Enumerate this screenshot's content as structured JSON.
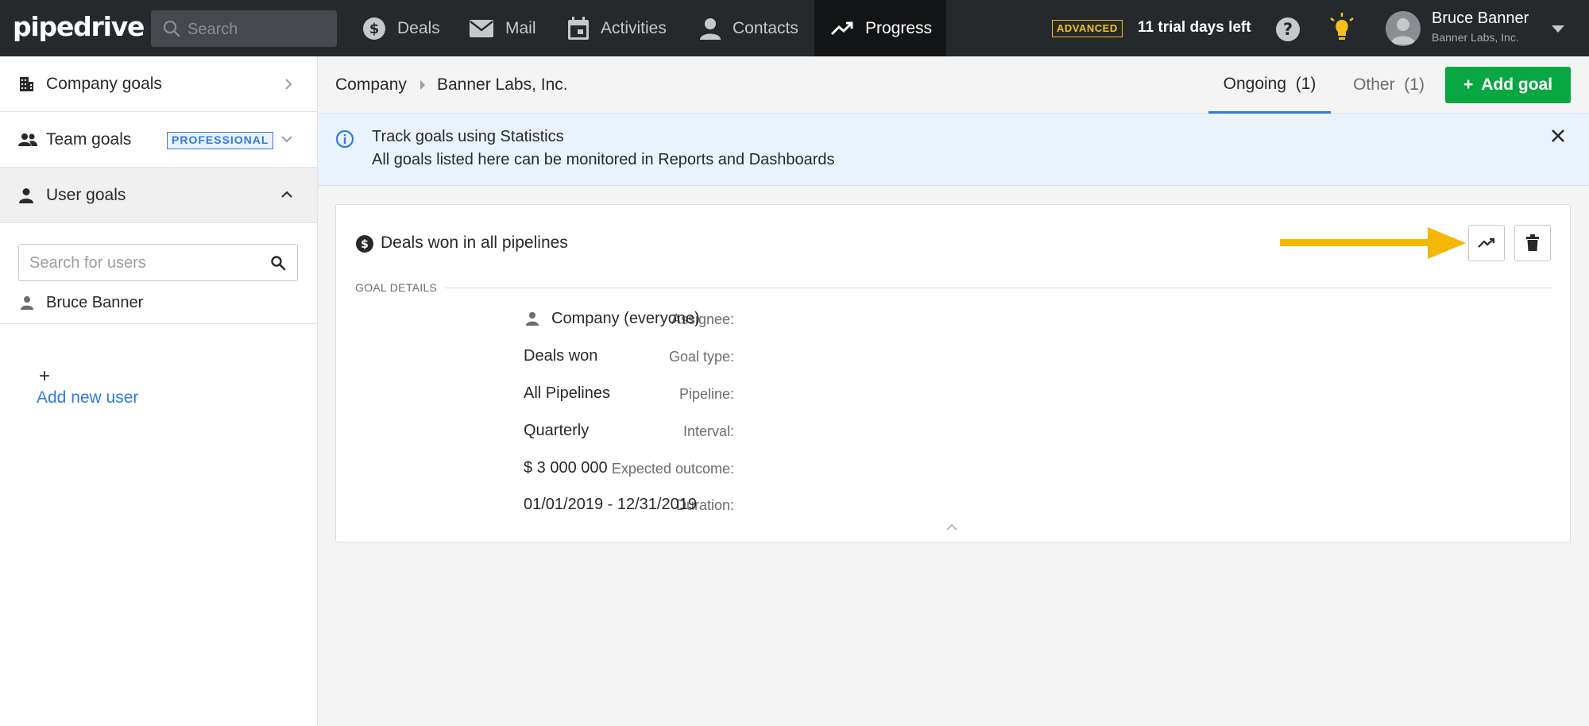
{
  "app": {
    "logo_text": "pipedrive",
    "search_placeholder": "Search",
    "nav": {
      "deals": "Deals",
      "mail": "Mail",
      "activities": "Activities",
      "contacts": "Contacts",
      "progress": "Progress"
    },
    "plan_badge": "ADVANCED",
    "trial_text": "11 trial days left",
    "user_name": "Bruce Banner",
    "user_company": "Banner Labs, Inc."
  },
  "sidebar": {
    "company_goals": "Company goals",
    "team_goals": "Team goals",
    "team_badge": "PROFESSIONAL",
    "user_goals": "User goals",
    "user_search_placeholder": "Search for users",
    "users": [
      "Bruce Banner"
    ],
    "add_plus": "+",
    "add_new_user": "Add new user"
  },
  "header": {
    "breadcrumb_root": "Company",
    "breadcrumb_current": "Banner Labs, Inc.",
    "tab_ongoing": "Ongoing",
    "tab_ongoing_count": "(1)",
    "tab_other": "Other",
    "tab_other_count": "(1)",
    "add_goal_label": "Add goal",
    "add_goal_plus": "+"
  },
  "banner": {
    "title": "Track goals using Statistics",
    "text": "All goals listed here can be monitored in Reports and Dashboards"
  },
  "goal": {
    "title": "Deals won in all pipelines",
    "section_title": "GOAL DETAILS",
    "details": {
      "assignee_label": "Assignee:",
      "assignee_value": "Company (everyone)",
      "goal_type_label": "Goal type:",
      "goal_type_value": "Deals won",
      "pipeline_label": "Pipeline:",
      "pipeline_value": "All Pipelines",
      "interval_label": "Interval:",
      "interval_value": "Quarterly",
      "expected_label": "Expected outcome:",
      "expected_value": "$ 3 000 000",
      "duration_label": "Duration:",
      "duration_value": "01/01/2019 - 12/31/2019"
    }
  },
  "colors": {
    "topbar": "#26292c",
    "accent_blue": "#317ae2",
    "add_green": "#08a742",
    "annotation_arrow": "#f5b800",
    "advanced_badge": "#f5c11a"
  }
}
